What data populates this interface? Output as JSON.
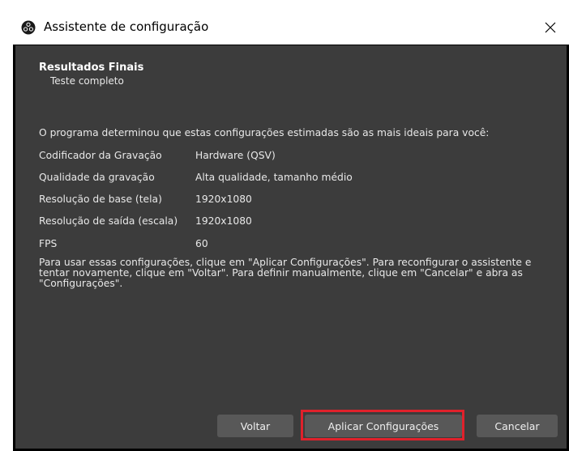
{
  "window": {
    "title": "Assistente de configuração",
    "close_glyph": "✕",
    "icon": "obs-logo-icon"
  },
  "page": {
    "title": "Resultados Finais",
    "subtitle": "Teste completo"
  },
  "intro": "O programa determinou que estas configurações estimadas são as mais ideais para você:",
  "settings": [
    {
      "label": "Codificador da Gravação",
      "value": "Hardware (QSV)"
    },
    {
      "label": "Qualidade da gravação",
      "value": "Alta qualidade, tamanho médio"
    },
    {
      "label": "Resolução de base (tela)",
      "value": "1920x1080"
    },
    {
      "label": "Resolução de saída (escala)",
      "value": "1920x1080"
    },
    {
      "label": "FPS",
      "value": "60"
    }
  ],
  "note": "Para usar essas configurações, clique em \"Aplicar Configurações\". Para reconfigurar o assistente e tentar novamente, clique em \"Voltar\". Para definir manualmente, clique em \"Cancelar\" e abra as \"Configurações\".",
  "buttons": {
    "back": "Voltar",
    "apply": "Aplicar Configurações",
    "cancel": "Cancelar"
  },
  "colors": {
    "panel_bg": "#3c3c3c",
    "button_bg": "#585858",
    "highlight": "#e0212b"
  }
}
